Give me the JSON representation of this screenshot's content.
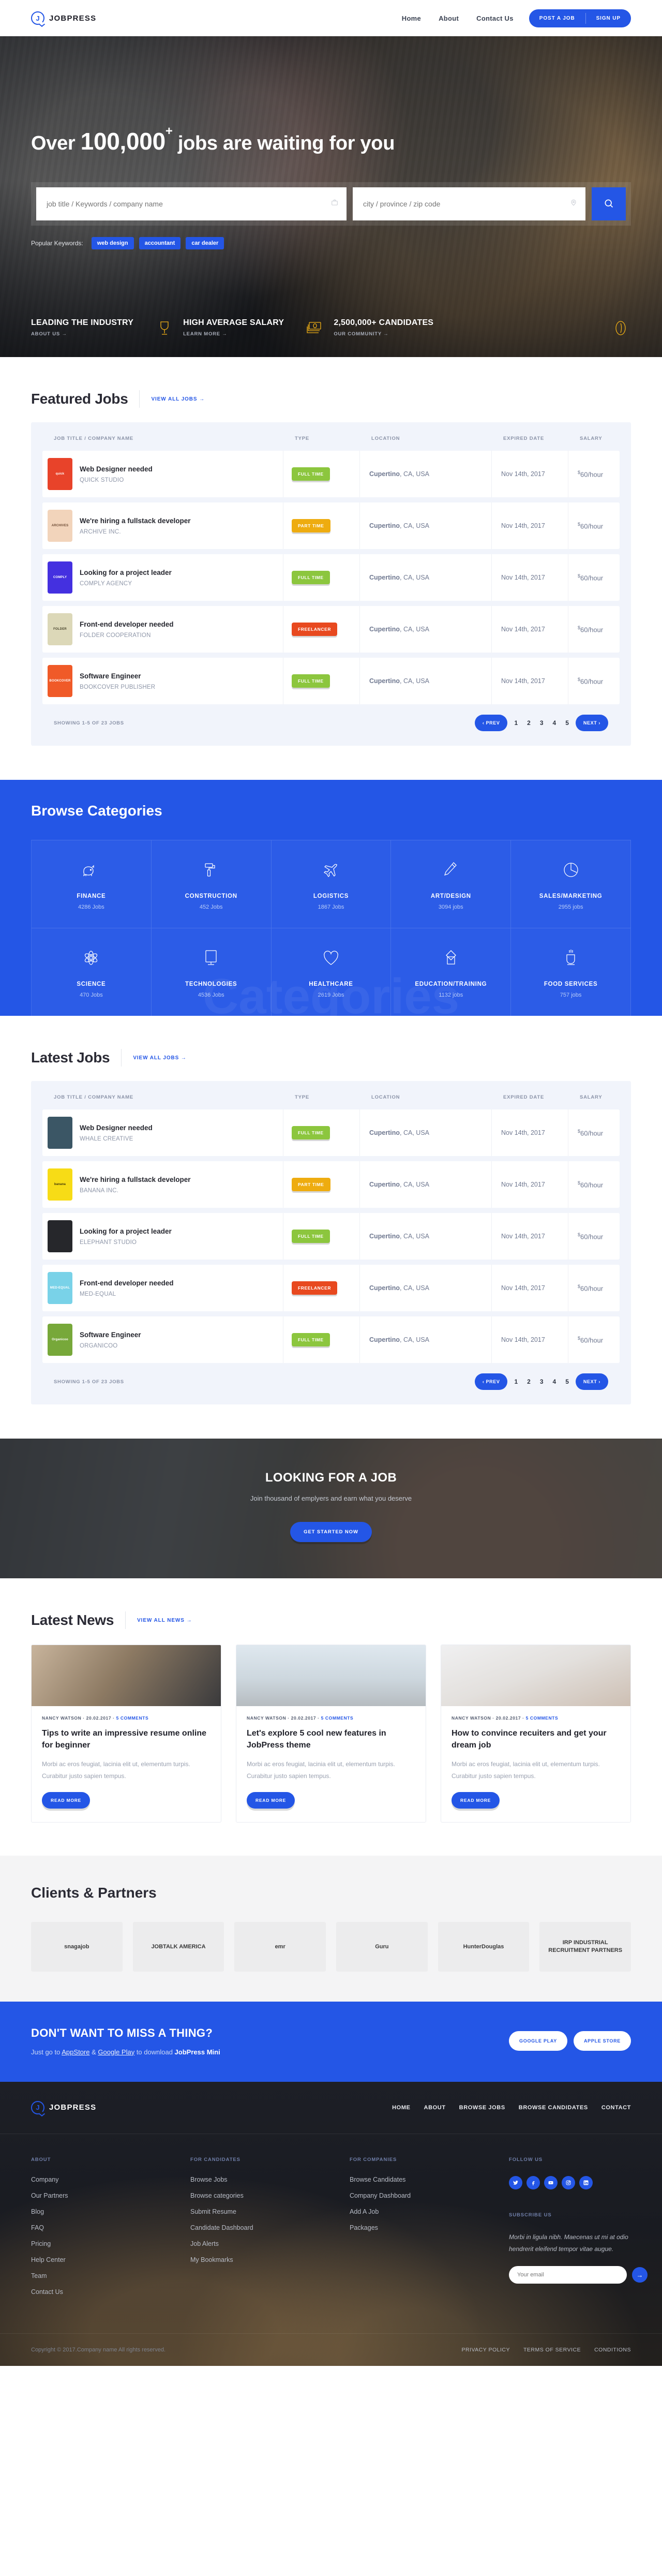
{
  "header": {
    "brand": "JOBPRESS",
    "nav": [
      "Home",
      "About",
      "Contact Us"
    ],
    "post_job": "POST A JOB",
    "sign_up": "SIGN UP"
  },
  "hero": {
    "title_pre": "Over ",
    "title_big": "100,000",
    "title_sup": "+",
    "title_post": " jobs are waiting for you",
    "keyword_placeholder": "job title / Keywords / company name",
    "location_placeholder": "city / province / zip code",
    "popular_label": "Popular Keywords:",
    "popular_keywords": [
      "web design",
      "accountant",
      "car dealer"
    ],
    "stats": [
      {
        "title": "LEADING THE INDUSTRY",
        "link": "ABOUT US →",
        "icon": "user-icon"
      },
      {
        "title": "HIGH AVERAGE SALARY",
        "link": "LEARN MORE →",
        "icon": "trophy-icon"
      },
      {
        "title": "2,500,000+ CANDIDATES",
        "link": "OUR COMMUNITY →",
        "icon": "money-icon"
      }
    ]
  },
  "featured": {
    "heading": "Featured Jobs",
    "view_all": "VIEW ALL JOBS →",
    "columns": [
      "JOB TITLE / COMPANY NAME",
      "TYPE",
      "LOCATION",
      "EXPIRED DATE",
      "SALARY"
    ],
    "rows": [
      {
        "title": "Web Designer needed",
        "company": "QUICK STUDIO",
        "type": "FULL TIME",
        "type_key": "full",
        "city": "Cupertino",
        "region": ", CA, USA",
        "date": "Nov 14th",
        "date_sup": "th",
        "date_year": ", 2017",
        "salary": "60/hour",
        "logo_text": "quick",
        "logo_bg": "#e8432a",
        "logo_fg": "#ffffff"
      },
      {
        "title": "We're hiring a fullstack developer",
        "company": "ARCHIVE INC.",
        "type": "PART TIME",
        "type_key": "part",
        "city": "Cupertino",
        "region": ", CA, USA",
        "date": "Nov 14th",
        "date_sup": "th",
        "date_year": ", 2017",
        "salary": "60/hour",
        "logo_text": "ARCHIVES",
        "logo_bg": "#f2d4bb",
        "logo_fg": "#6b4a33"
      },
      {
        "title": "Looking for a project leader",
        "company": "COMPLY AGENCY",
        "type": "FULL TIME",
        "type_key": "full",
        "city": "Cupertino",
        "region": ", CA, USA",
        "date": "Nov 14th",
        "date_sup": "th",
        "date_year": ", 2017",
        "salary": "60/hour",
        "logo_text": "COMPLY",
        "logo_bg": "#4430e0",
        "logo_fg": "#ffffff"
      },
      {
        "title": "Front-end developer needed",
        "company": "FOLDER COOPERATION",
        "type": "FREELANCER",
        "type_key": "free",
        "city": "Cupertino",
        "region": ", CA, USA",
        "date": "Nov 14th",
        "date_sup": "th",
        "date_year": ", 2017",
        "salary": "60/hour",
        "logo_text": "FOLDER",
        "logo_bg": "#dcd8b8",
        "logo_fg": "#4a462e"
      },
      {
        "title": "Software Engineer",
        "company": "BOOKCOVER PUBLISHER",
        "type": "FULL TIME",
        "type_key": "full",
        "city": "Cupertino",
        "region": ", CA, USA",
        "date": "Nov 14th",
        "date_sup": "th",
        "date_year": ", 2017",
        "salary": "60/hour",
        "logo_text": "BOOKCOVER",
        "logo_bg": "#f05a28",
        "logo_fg": "#ffffff"
      }
    ],
    "showing": "SHOWING 1-5 OF 23 JOBS",
    "prev": "‹ PREV",
    "next": "NEXT ›",
    "pages": [
      "1",
      "2",
      "3",
      "4",
      "5"
    ]
  },
  "categories": {
    "heading": "Browse Categories",
    "ghost": "Categories",
    "items": [
      {
        "name": "FINANCE",
        "count": "4286 Jobs",
        "icon": "piggy-bank-icon"
      },
      {
        "name": "CONSTRUCTION",
        "count": "452 Jobs",
        "icon": "paint-roller-icon"
      },
      {
        "name": "LOGISTICS",
        "count": "1867 Jobs",
        "icon": "airplane-icon"
      },
      {
        "name": "ART/DESIGN",
        "count": "3094 jobs",
        "icon": "pencil-icon"
      },
      {
        "name": "SALES/MARKETING",
        "count": "2955 jobs",
        "icon": "pie-chart-icon"
      },
      {
        "name": "SCIENCE",
        "count": "470 Jobs",
        "icon": "atom-icon"
      },
      {
        "name": "TECHNOLOGIES",
        "count": "4536 Jobs",
        "icon": "monitor-icon"
      },
      {
        "name": "HEALTHCARE",
        "count": "2619 Jobs",
        "icon": "heart-icon"
      },
      {
        "name": "EDUCATION/TRAINING",
        "count": "1132 jobs",
        "icon": "graduation-cap-icon"
      },
      {
        "name": "FOOD SERVICES",
        "count": "757 jobs",
        "icon": "coffee-cup-icon"
      }
    ]
  },
  "latest": {
    "heading": "Latest Jobs",
    "view_all": "VIEW ALL JOBS →",
    "columns": [
      "JOB TITLE / COMPANY NAME",
      "TYPE",
      "LOCATION",
      "EXPIRED DATE",
      "SALARY"
    ],
    "rows": [
      {
        "title": "Web Designer needed",
        "company": "WHALE CREATIVE",
        "type": "FULL TIME",
        "type_key": "full",
        "city": "Cupertino",
        "region": ", CA, USA",
        "date": "Nov 14th",
        "date_sup": "th",
        "date_year": ", 2017",
        "salary": "60/hour",
        "logo_text": "",
        "logo_bg": "#3b5665",
        "logo_fg": "#ffffff"
      },
      {
        "title": "We're hiring a fullstack developer",
        "company": "BANANA INC.",
        "type": "PART TIME",
        "type_key": "part",
        "city": "Cupertino",
        "region": ", CA, USA",
        "date": "Nov 14th",
        "date_sup": "th",
        "date_year": ", 2017",
        "salary": "60/hour",
        "logo_text": "banana",
        "logo_bg": "#f7dc16",
        "logo_fg": "#3a3109"
      },
      {
        "title": "Looking for a project leader",
        "company": "ELEPHANT STUDIO",
        "type": "FULL TIME",
        "type_key": "full",
        "city": "Cupertino",
        "region": ", CA, USA",
        "date": "Nov 14th",
        "date_sup": "th",
        "date_year": ", 2017",
        "salary": "60/hour",
        "logo_text": "",
        "logo_bg": "#26272b",
        "logo_fg": "#d7c0a5"
      },
      {
        "title": "Front-end developer needed",
        "company": "MED-EQUAL",
        "type": "FREELANCER",
        "type_key": "free",
        "city": "Cupertino",
        "region": ", CA, USA",
        "date": "Nov 14th",
        "date_sup": "th",
        "date_year": ", 2017",
        "salary": "60/hour",
        "logo_text": "MED-EQUAL",
        "logo_bg": "#79d2e8",
        "logo_fg": "#ffffff"
      },
      {
        "title": "Software Engineer",
        "company": "ORGANICOO",
        "type": "FULL TIME",
        "type_key": "full",
        "city": "Cupertino",
        "region": ", CA, USA",
        "date": "Nov 14th",
        "date_sup": "th",
        "date_year": ", 2017",
        "salary": "60/hour",
        "logo_text": "Organicoo",
        "logo_bg": "#77a83a",
        "logo_fg": "#ffffff"
      }
    ],
    "showing": "SHOWING 1-5 OF 23 JOBS",
    "prev": "‹ PREV",
    "next": "NEXT ›",
    "pages": [
      "1",
      "2",
      "3",
      "4",
      "5"
    ]
  },
  "cta": {
    "heading": "LOOKING FOR A JOB",
    "sub": "Join thousand of emplyers and earn what you deserve",
    "button": "GET STARTED NOW"
  },
  "news": {
    "heading": "Latest News",
    "view_all": "VIEW ALL NEWS →",
    "read_more": "READ MORE",
    "posts": [
      {
        "author": "NANCY WATSON",
        "date": "20.02.2017",
        "comments": "5 COMMENTS",
        "title": "Tips to write an impressive resume online for beginner",
        "excerpt": "Morbi ac eros feugiat, lacinia elit ut, elementum turpis. Curabitur justo sapien tempus."
      },
      {
        "author": "NANCY WATSON",
        "date": "20.02.2017",
        "comments": "5 COMMENTS",
        "title": "Let's explore 5 cool new features in JobPress theme",
        "excerpt": "Morbi ac eros feugiat, lacinia elit ut, elementum turpis. Curabitur justo sapien tempus."
      },
      {
        "author": "NANCY WATSON",
        "date": "20.02.2017",
        "comments": "5 COMMENTS",
        "title": "How to convince recuiters and get your dream job",
        "excerpt": "Morbi ac eros feugiat, lacinia elit ut, elementum turpis. Curabitur justo sapien tempus."
      }
    ]
  },
  "clients": {
    "heading": "Clients & Partners",
    "logos": [
      "snagajob",
      "JOBTALK AMERICA",
      "emr",
      "Guru",
      "HunterDouglas",
      "IRP INDUSTRIAL RECRUITMENT PARTNERS"
    ]
  },
  "app": {
    "heading": "DON'T WANT TO MISS A THING?",
    "sub_pre": "Just go to ",
    "sub_link1": "AppStore",
    "sub_mid": " & ",
    "sub_link2": "Google Play",
    "sub_post": " to download ",
    "sub_bold": "JobPress Mini",
    "google_play": "GOOGLE PLAY",
    "apple_store": "APPLE STORE"
  },
  "footer": {
    "brand": "JOBPRESS",
    "nav": [
      "HOME",
      "ABOUT",
      "BROWSE JOBS",
      "BROWSE CANDIDATES",
      "CONTACT"
    ],
    "columns": [
      {
        "title": "ABOUT",
        "links": [
          "Company",
          "Our Partners",
          "Blog",
          "FAQ",
          "Pricing",
          "Help Center",
          "Team",
          "Contact Us"
        ]
      },
      {
        "title": "FOR CANDIDATES",
        "links": [
          "Browse Jobs",
          "Browse categories",
          "Submit Resume",
          "Candidate Dashboard",
          "Job Alerts",
          "My Bookmarks"
        ]
      },
      {
        "title": "FOR COMPANIES",
        "links": [
          "Browse Candidates",
          "Company Dashboard",
          "Add A Job",
          "Packages"
        ]
      }
    ],
    "follow_title": "FOLLOW US",
    "socials": [
      "twitter-icon",
      "facebook-icon",
      "youtube-icon",
      "instagram-icon",
      "linkedin-icon"
    ],
    "subscribe_title": "SUBSCRIBE US",
    "subscribe_note": "Morbi in ligula nibh. Maecenas ut mi at odio hendrerit eleifend tempor vitae augue.",
    "email_placeholder": "Your email",
    "copyright": "Copyright © 2017.Company name All rights reserved.",
    "legal": [
      "PRIVACY POLICY",
      "TERMS OF SERVICE",
      "CONDITIONS"
    ]
  }
}
